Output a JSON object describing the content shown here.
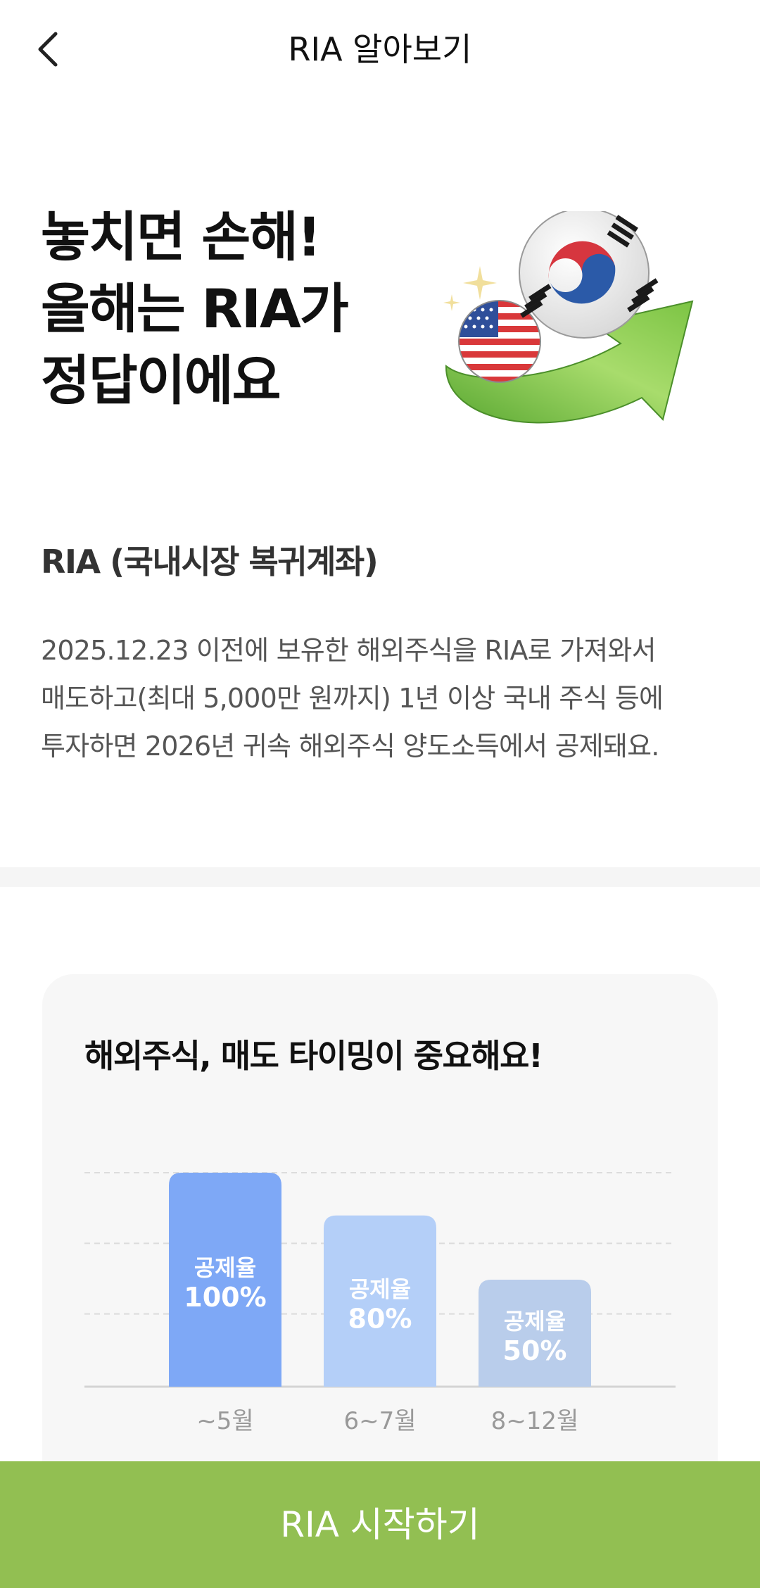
{
  "header": {
    "title": "RIA 알아보기"
  },
  "hero": {
    "title_lines": [
      "놓치면 손해!",
      "올해는 RIA가",
      "정답이에요"
    ]
  },
  "info": {
    "heading": "RIA (국내시장 복귀계좌)",
    "description_lines": [
      "2025.12.23 이전에 보유한 해외주식을 RIA로 가져와서",
      "매도하고(최대 5,000만 원까지) 1년 이상 국내 주식 등에",
      "투자하면 2026년 귀속 해외주식 양도소득에서 공제돼요."
    ]
  },
  "card": {
    "title": "해외주식, 매도 타이밍이 중요해요!"
  },
  "chart_data": {
    "type": "bar",
    "categories": [
      "~5월",
      "6~7월",
      "8~12월"
    ],
    "values": [
      100,
      80,
      50
    ],
    "bar_labels": [
      "공제율",
      "공제율",
      "공제율"
    ],
    "value_labels": [
      "100%",
      "80%",
      "50%"
    ],
    "colors": [
      "#7ea8f6",
      "#b4cff8",
      "#b9cdeb"
    ],
    "grid": true,
    "ylim": [
      0,
      100
    ]
  },
  "cta": {
    "label": "RIA 시작하기"
  },
  "colors": {
    "accent": "#92bf52"
  }
}
